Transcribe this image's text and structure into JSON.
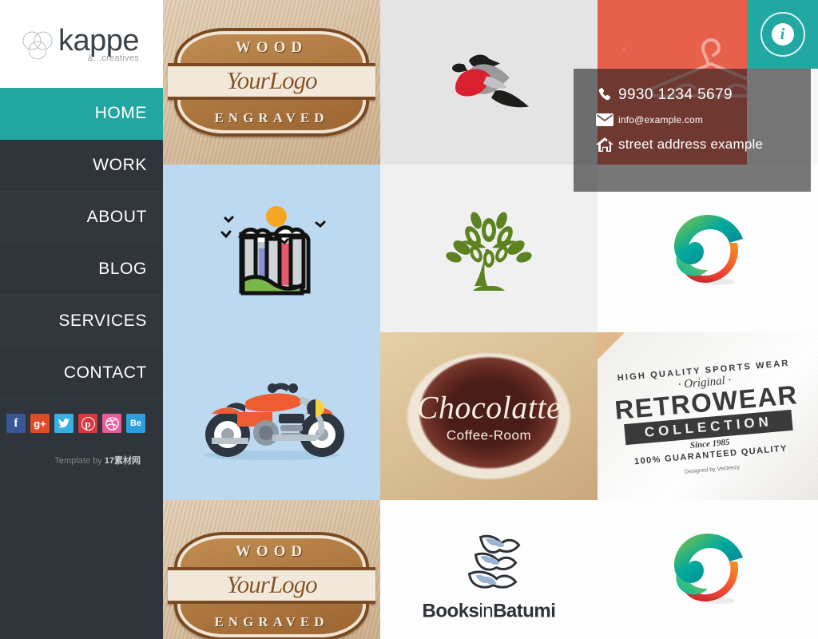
{
  "brand": {
    "name": "kappe",
    "tagline": "&...creatives",
    "logo_icon": "three-circles-mark",
    "accent_color": "#23a6a0",
    "sidebar_color": "#2f353b"
  },
  "nav": {
    "items": [
      {
        "label": "HOME",
        "active": true
      },
      {
        "label": "WORK",
        "active": false
      },
      {
        "label": "ABOUT",
        "active": false
      },
      {
        "label": "BLOG",
        "active": false
      },
      {
        "label": "SERVICES",
        "active": false
      },
      {
        "label": "CONTACT",
        "active": false
      }
    ]
  },
  "social": [
    {
      "name": "facebook",
      "glyph": "f",
      "color": "#3a5795"
    },
    {
      "name": "google-plus",
      "glyph": "g+",
      "color": "#dd4b28"
    },
    {
      "name": "twitter",
      "glyph": "t",
      "color": "#3ab0e2"
    },
    {
      "name": "pinterest",
      "glyph": "p",
      "color": "#d6383f"
    },
    {
      "name": "dribbble",
      "glyph": "d",
      "color": "#ef5a9c"
    },
    {
      "name": "behance",
      "glyph": "Be",
      "color": "#2f9ede"
    }
  ],
  "footer": {
    "credit_prefix": "Template by ",
    "credit_link": "17素材网"
  },
  "info_button": {
    "icon": "info-icon",
    "glyph": "i",
    "background": "#21a8a2"
  },
  "contact": {
    "phone": "9930 1234 5679",
    "email": "info@example.com",
    "address": "street address example",
    "phone_icon": "phone-icon",
    "email_icon": "envelope-icon",
    "address_icon": "home-icon"
  },
  "tiles": [
    {
      "id": "wood-engraved-1",
      "title_top": "WOOD",
      "title_mid": "YourLogo",
      "title_bottom": "ENGRAVED",
      "bg": "wood"
    },
    {
      "id": "bird-logo-1",
      "title": "bullfinch bird logo",
      "bg": "light-grey"
    },
    {
      "id": "clothes-hanger-red",
      "title": "clothes hanger outline",
      "bg": "red"
    },
    {
      "id": "info-tile",
      "title": "info",
      "bg": "teal"
    },
    {
      "id": "castle-landscape",
      "title": "castle landscape illustration",
      "bg": "baby-blue"
    },
    {
      "id": "tree-logo",
      "title": "olive tree logo",
      "bg": "off-white"
    },
    {
      "id": "gradient-swirl-1",
      "title": "gradient swirl logo",
      "bg": "white"
    },
    {
      "id": "motorcycle",
      "title": "red motorcycle illustration",
      "bg": "baby-blue"
    },
    {
      "id": "chocolatte",
      "name": "Chocolatte",
      "sub": "Coffee-Room",
      "bg": "coffee-photo"
    },
    {
      "id": "retrowear",
      "l1": "HIGH QUALITY SPORTS WEAR",
      "l2": "· Original ·",
      "l3": "RETROWEAR",
      "l4": "COLLECTION",
      "l5": "Since 1985",
      "l6": "100% GUARANTEED QUALITY",
      "l7": "Designed by Vecteezy",
      "bg": "paper-photo"
    },
    {
      "id": "wood-engraved-2",
      "title_top": "WOOD",
      "title_mid": "YourLogo",
      "title_bottom": "ENGRAVED",
      "bg": "wood"
    },
    {
      "id": "books-in-batumi",
      "name_a": "Books",
      "name_b": "in",
      "name_c": "Batumi",
      "bg": "white"
    },
    {
      "id": "gradient-swirl-2",
      "title": "gradient swirl logo",
      "bg": "white"
    }
  ]
}
